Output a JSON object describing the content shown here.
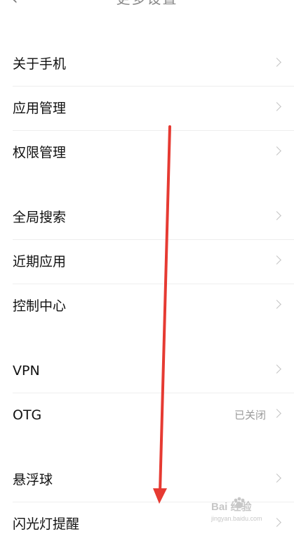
{
  "header": {
    "title": "更多设置",
    "back_icon": "chevron-left-icon"
  },
  "groups": [
    {
      "items": [
        {
          "label": "关于手机",
          "value": ""
        },
        {
          "label": "应用管理",
          "value": ""
        },
        {
          "label": "权限管理",
          "value": ""
        }
      ]
    },
    {
      "items": [
        {
          "label": "全局搜索",
          "value": ""
        },
        {
          "label": "近期应用",
          "value": ""
        },
        {
          "label": "控制中心",
          "value": ""
        }
      ]
    },
    {
      "items": [
        {
          "label": "VPN",
          "value": ""
        },
        {
          "label": "OTG",
          "value": "已关闭"
        }
      ]
    },
    {
      "items": [
        {
          "label": "悬浮球",
          "value": ""
        },
        {
          "label": "闪光灯提醒",
          "value": ""
        }
      ]
    }
  ],
  "watermark": {
    "brand": "Bai 经验",
    "url": "jingyan.baidu.com"
  },
  "annotation": {
    "arrow_color": "#e63a32"
  }
}
